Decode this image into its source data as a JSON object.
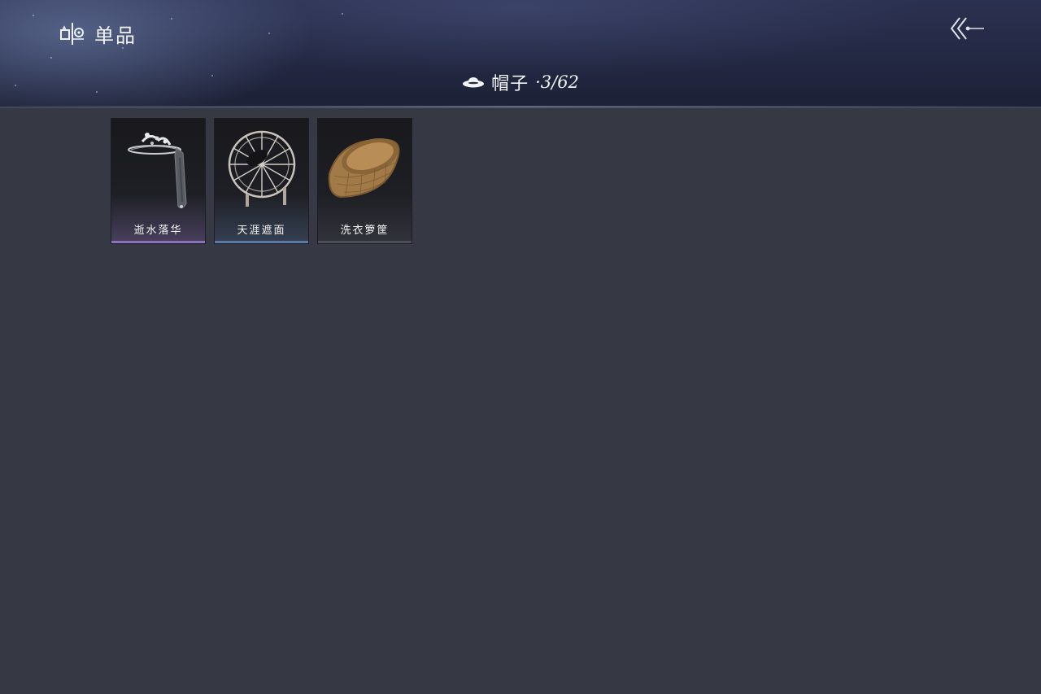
{
  "header": {
    "section_label": "单品",
    "section_icon": "wardrobe-icon",
    "back_icon": "back-arrow-icon"
  },
  "category": {
    "icon": "hat-icon",
    "name": "帽子",
    "count": "·3/62"
  },
  "items": [
    {
      "name": "逝水落华",
      "icon": "jeweled-veil-hat-icon",
      "accent": "#8a73b8"
    },
    {
      "name": "天涯遮面",
      "icon": "woven-round-veil-hat-icon",
      "accent": "#5b7aa6"
    },
    {
      "name": "洗衣箩筐",
      "icon": "wicker-basket-hat-icon",
      "accent": "#4a4d58"
    }
  ],
  "colors": {
    "background": "#363943",
    "header": "#232843",
    "text": "#f3f4f8"
  }
}
